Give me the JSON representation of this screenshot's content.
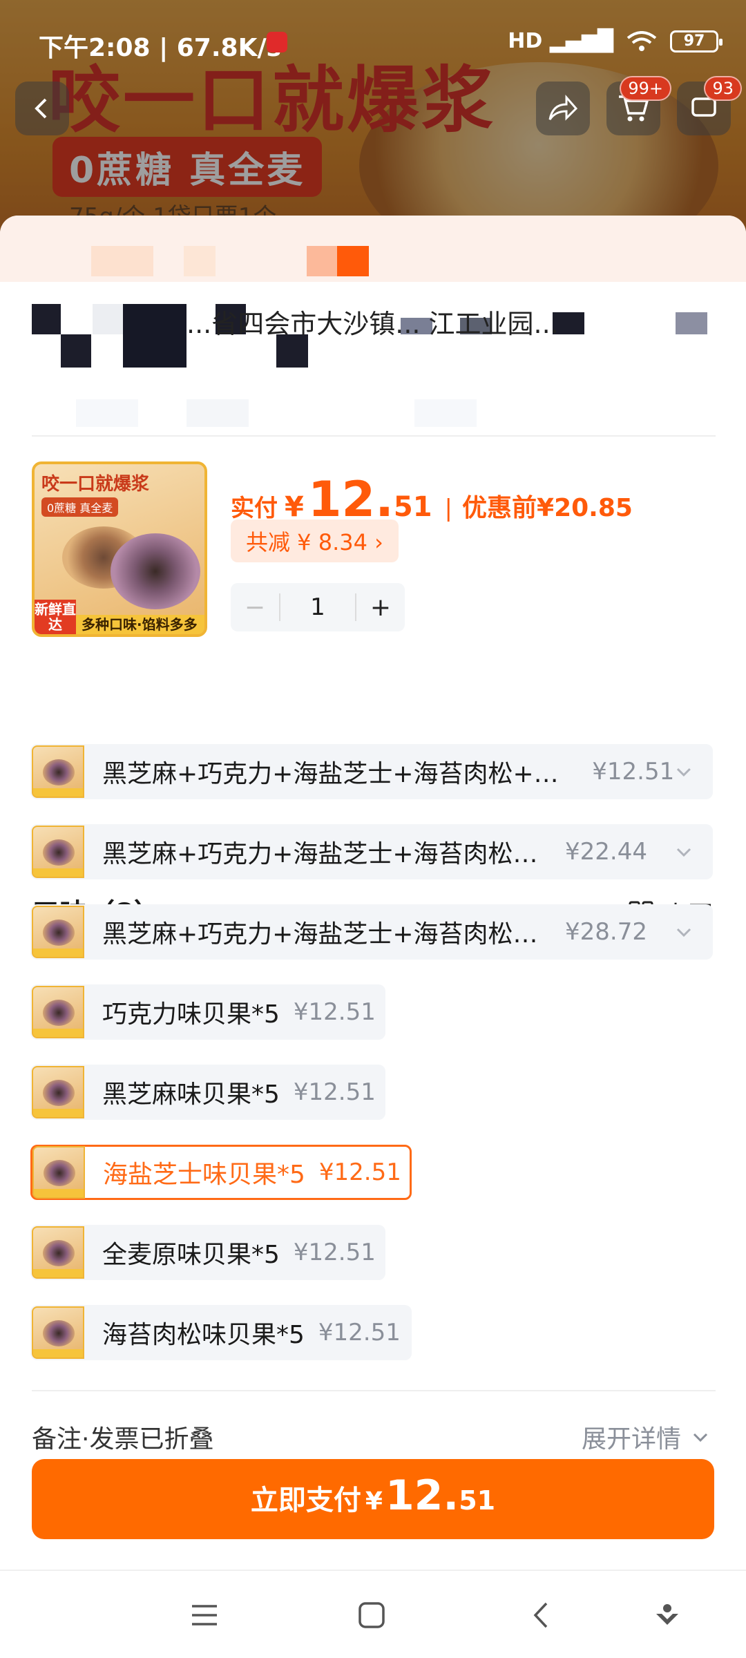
{
  "status_bar": {
    "time_speed": "下午2:08 | 67.8K/s",
    "network": "HD",
    "battery": "97"
  },
  "hero": {
    "slogan": "咬一口就爆浆",
    "tag": "0蔗糖 真全麦",
    "sub": "75g/个 1袋只要1个"
  },
  "top_bar": {
    "cart_badge": "99+",
    "message_badge": "93"
  },
  "address": {
    "line": "...省四会市大沙镇... 江工业园..."
  },
  "product": {
    "thumb_title": "咬一口就爆浆",
    "thumb_tags": "0蔗糖 真全麦",
    "thumb_fresh": "新鲜直达",
    "thumb_footer": "多种口味·馅料多多",
    "pay_label": "实付",
    "currency": "¥",
    "price_int": "12.",
    "price_dec": "51",
    "price_before_label": "优惠前",
    "price_before": "¥20.85",
    "discount_text": "共减 ¥ 8.34 ›",
    "quantity": "1",
    "minus": "−",
    "plus": "+"
  },
  "flavors": {
    "header": "口味（8）",
    "big_picture_label": "大图",
    "options": [
      {
        "label": "黑芝麻+巧克力+海盐芝士+海苔肉松+全...",
        "price": "¥12.51",
        "selected": false,
        "expandable": true
      },
      {
        "label": "黑芝麻+巧克力+海盐芝士+海苔肉松+...",
        "price": "¥22.44",
        "selected": false,
        "expandable": true
      },
      {
        "label": "黑芝麻+巧克力+海盐芝士+海苔肉松+...",
        "price": "¥28.72",
        "selected": false,
        "expandable": true
      },
      {
        "label": "巧克力味贝果*5",
        "price": "¥12.51",
        "selected": false,
        "expandable": false
      },
      {
        "label": "黑芝麻味贝果*5",
        "price": "¥12.51",
        "selected": false,
        "expandable": false
      },
      {
        "label": "海盐芝士味贝果*5",
        "price": "¥12.51",
        "selected": true,
        "expandable": false
      },
      {
        "label": "全麦原味贝果*5",
        "price": "¥12.51",
        "selected": false,
        "expandable": false
      },
      {
        "label": "海苔肉松味贝果*5",
        "price": "¥12.51",
        "selected": false,
        "expandable": false
      }
    ]
  },
  "footer": {
    "remark_label": "备注·发票已折叠",
    "expand_label": "展开详情",
    "pay_button_label": "立即支付",
    "pay_currency": "¥",
    "pay_int": "12.",
    "pay_dec": "51"
  },
  "colors": {
    "accent": "#ff6a00",
    "price": "#ff5a0a",
    "option_bg": "#f3f5f8"
  }
}
